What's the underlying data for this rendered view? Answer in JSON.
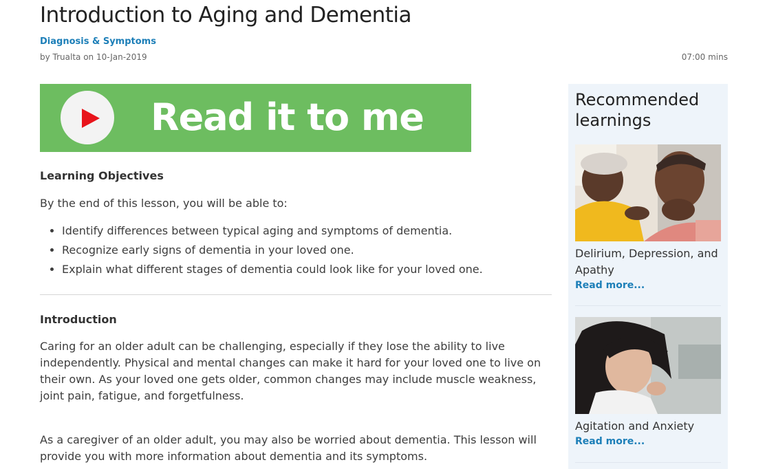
{
  "article": {
    "title": "Introduction to Aging and Dementia",
    "category": "Diagnosis & Symptoms",
    "byline": "by Trualta on 10-Jan-2019",
    "duration": "07:00 mins"
  },
  "banner": {
    "label": "Read it to me",
    "play_icon": "play-icon",
    "color": "#6dbd60"
  },
  "objectives": {
    "heading": "Learning Objectives",
    "intro": "By the end of this lesson, you will be able to:",
    "items": [
      "Identify differences between typical aging and symptoms of dementia.",
      "Recognize early signs of dementia in your loved one.",
      "Explain what different stages of dementia could look like for your loved one."
    ]
  },
  "introduction": {
    "heading": "Introduction",
    "paragraphs": [
      "Caring for an older adult can be challenging, especially if they lose the ability to live independently. Physical and mental changes can make it hard for your loved one to live on their own. As your loved one gets older, common changes may include muscle weakness, joint pain, fatigue, and forgetfulness.",
      "As a caregiver of an older adult, you may also be worried about dementia. This lesson will provide you with more information about dementia and its symptoms."
    ]
  },
  "sidebar": {
    "heading": "Recommended learnings",
    "cards": [
      {
        "title": "Delirium, Depression, and Apathy",
        "link": "Read more..."
      },
      {
        "title": "Agitation and Anxiety",
        "link": "Read more..."
      }
    ]
  },
  "colors": {
    "accent": "#1d7fb8",
    "play": "#e8141b",
    "sidebar_bg": "#eef4fa"
  }
}
